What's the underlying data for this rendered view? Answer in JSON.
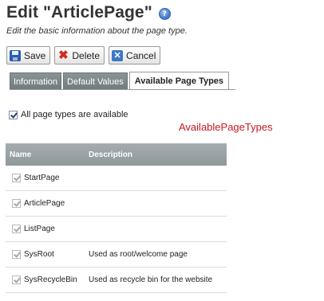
{
  "header": {
    "title": "Edit \"ArticlePage\"",
    "help_icon": "question-help-icon",
    "subtitle": "Edit the basic information about the page type."
  },
  "toolbar": {
    "save_label": "Save",
    "delete_label": "Delete",
    "cancel_label": "Cancel",
    "save_icon": "floppy-disk-icon",
    "delete_icon": "red-x-icon",
    "cancel_icon": "cancel-icon"
  },
  "tabs": [
    {
      "label": "Information",
      "active": false
    },
    {
      "label": "Default Values",
      "active": false
    },
    {
      "label": "Available Page Types",
      "active": true
    }
  ],
  "all_types": {
    "label": "All page types are available",
    "checked": true
  },
  "annotation": "AvailablePageTypes",
  "grid": {
    "columns": {
      "name": "Name",
      "description": "Description"
    },
    "rows": [
      {
        "name": "StartPage",
        "description": "",
        "checked": true
      },
      {
        "name": "ArticlePage",
        "description": "",
        "checked": true
      },
      {
        "name": "ListPage",
        "description": "",
        "checked": true
      },
      {
        "name": "SysRoot",
        "description": "Used as root/welcome page",
        "checked": true
      },
      {
        "name": "SysRecycleBin",
        "description": "Used as recycle bin for the website",
        "checked": true
      }
    ]
  },
  "colors": {
    "annotation": "#c8181f",
    "tab_inactive": "#7c8689",
    "grid_header": "#9aa2a5"
  }
}
